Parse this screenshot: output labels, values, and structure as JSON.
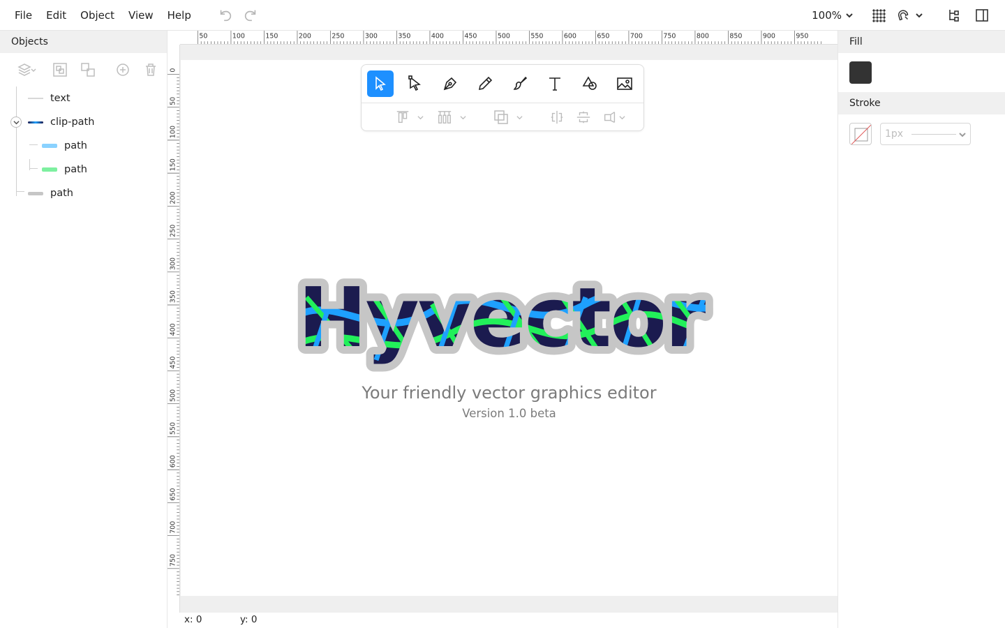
{
  "menu": {
    "file": "File",
    "edit": "Edit",
    "object": "Object",
    "view": "View",
    "help": "Help"
  },
  "topbar": {
    "zoom": "100%"
  },
  "objects_panel": {
    "title": "Objects",
    "tree": [
      {
        "label": "text"
      },
      {
        "label": "clip-path"
      },
      {
        "label": "path"
      },
      {
        "label": "path"
      },
      {
        "label": "path"
      }
    ]
  },
  "rulers": {
    "top": [
      "50",
      "100",
      "150",
      "200",
      "250",
      "300",
      "350",
      "400",
      "450",
      "500",
      "550",
      "600",
      "650",
      "700",
      "750",
      "800",
      "850",
      "900",
      "950"
    ],
    "left": [
      "0",
      "50",
      "100",
      "150",
      "200",
      "250",
      "300",
      "350",
      "400",
      "450",
      "500",
      "550",
      "600",
      "650",
      "700",
      "750"
    ]
  },
  "canvas": {
    "logo_text": "Hyvector",
    "tagline": "Your friendly vector graphics editor",
    "version": "Version 1.0 beta"
  },
  "status": {
    "x": "x: 0",
    "y": "y: 0"
  },
  "properties": {
    "fill_label": "Fill",
    "fill_color": "#333333",
    "stroke_label": "Stroke",
    "stroke_width": "1px"
  },
  "colors": {
    "accent": "#1e90ff",
    "logo_navy": "#1b1b4f",
    "logo_blue": "#1ea0ff",
    "logo_green": "#22f05a",
    "logo_outline": "#c6c6c6"
  }
}
